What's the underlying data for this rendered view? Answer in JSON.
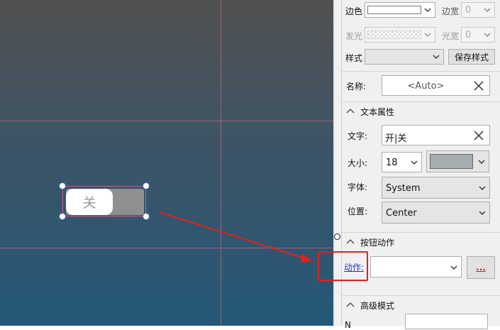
{
  "canvas": {
    "switch": {
      "state_text": "关"
    }
  },
  "appearance": {
    "border_label": "边色",
    "border_width_label": "边宽",
    "border_width_value": "0",
    "glow_label": "发光",
    "glow_width_label": "光宽",
    "glow_width_value": "0",
    "style_label": "样式",
    "style_value": "",
    "save_style_label": "保存样式"
  },
  "name_row": {
    "label": "名称:",
    "value": "<Auto>"
  },
  "text_props": {
    "title": "文本属性",
    "text_label": "文字:",
    "text_value": "开|关",
    "size_label": "大小:",
    "size_value": "18",
    "font_label": "字体:",
    "font_value": "System",
    "position_label": "位置:",
    "position_value": "Center",
    "text_color": "#a7aeb1"
  },
  "button_action": {
    "title": "按钮动作",
    "action_label": "动作:",
    "action_value": "",
    "more_label": "..."
  },
  "advanced": {
    "title": "高级模式",
    "partial_label": "N"
  },
  "colors": {
    "highlight": "#e02020",
    "link": "#1a3cc8"
  }
}
